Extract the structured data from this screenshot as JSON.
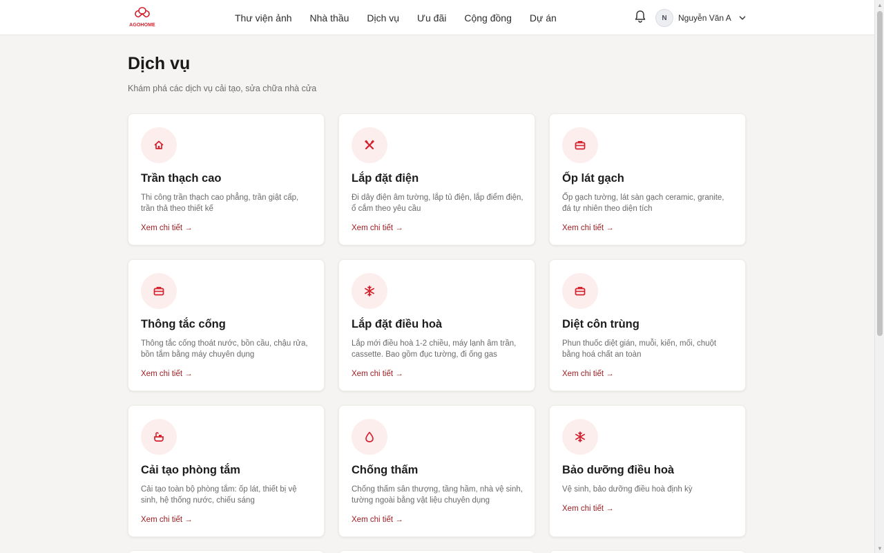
{
  "brand": {
    "name": "AGOHOME",
    "color": "#d4202c"
  },
  "nav": [
    "Thư viện ảnh",
    "Nhà thầu",
    "Dịch vụ",
    "Ưu đãi",
    "Cộng đồng",
    "Dự án"
  ],
  "user": {
    "initial": "N",
    "name": "Nguyễn Văn A"
  },
  "page": {
    "title": "Dịch vụ",
    "subtitle": "Khám phá các dịch vụ cải tạo, sửa chữa nhà cửa"
  },
  "accent": "#9c1a1f",
  "cards": [
    {
      "title": "Trần thạch cao",
      "desc": "Thi công trần thạch cao phẳng, trần giật cấp, trần thả theo thiết kế",
      "link": "Xem chi tiết →",
      "icon": "home-icon"
    },
    {
      "title": "Lắp đặt điện",
      "desc": "Đi dây điện âm tường, lắp tủ điện, lắp điểm điện, ổ cắm theo yêu cầu",
      "link": "Xem chi tiết →",
      "icon": "tools-icon"
    },
    {
      "title": "Ốp lát gạch",
      "desc": "Ốp gạch tường, lát sàn gạch ceramic, granite, đá tự nhiên theo diện tích",
      "link": "Xem chi tiết →",
      "icon": "toolbox-icon"
    },
    {
      "title": "Thông tắc cống",
      "desc": "Thông tắc cống thoát nước, bồn cầu, chậu rửa, bồn tắm bằng máy chuyên dụng",
      "link": "Xem chi tiết →",
      "icon": "toolbox-icon"
    },
    {
      "title": "Lắp đặt điều hoà",
      "desc": "Lắp mới điều hoà 1-2 chiều, máy lạnh âm trần, cassette. Bao gồm đục tường, đi ống gas",
      "link": "Xem chi tiết →",
      "icon": "snowflake-icon"
    },
    {
      "title": "Diệt côn trùng",
      "desc": "Phun thuốc diệt gián, muỗi, kiến, mối, chuột bằng hoá chất an toàn",
      "link": "Xem chi tiết →",
      "icon": "toolbox-icon"
    },
    {
      "title": "Cải tạo phòng tắm",
      "desc": "Cải tạo toàn bộ phòng tắm: ốp lát, thiết bị vệ sinh, hệ thống nước, chiếu sáng",
      "link": "Xem chi tiết →",
      "icon": "bathtub-icon"
    },
    {
      "title": "Chống thấm",
      "desc": "Chống thấm sân thượng, tầng hầm, nhà vệ sinh, tường ngoài bằng vật liệu chuyên dụng",
      "link": "Xem chi tiết →",
      "icon": "droplet-icon"
    },
    {
      "title": "Bảo dưỡng điều hoà",
      "desc": "Vệ sinh, bảo dưỡng điều hoà định kỳ",
      "link": "Xem chi tiết →",
      "icon": "snowflake-icon"
    }
  ]
}
